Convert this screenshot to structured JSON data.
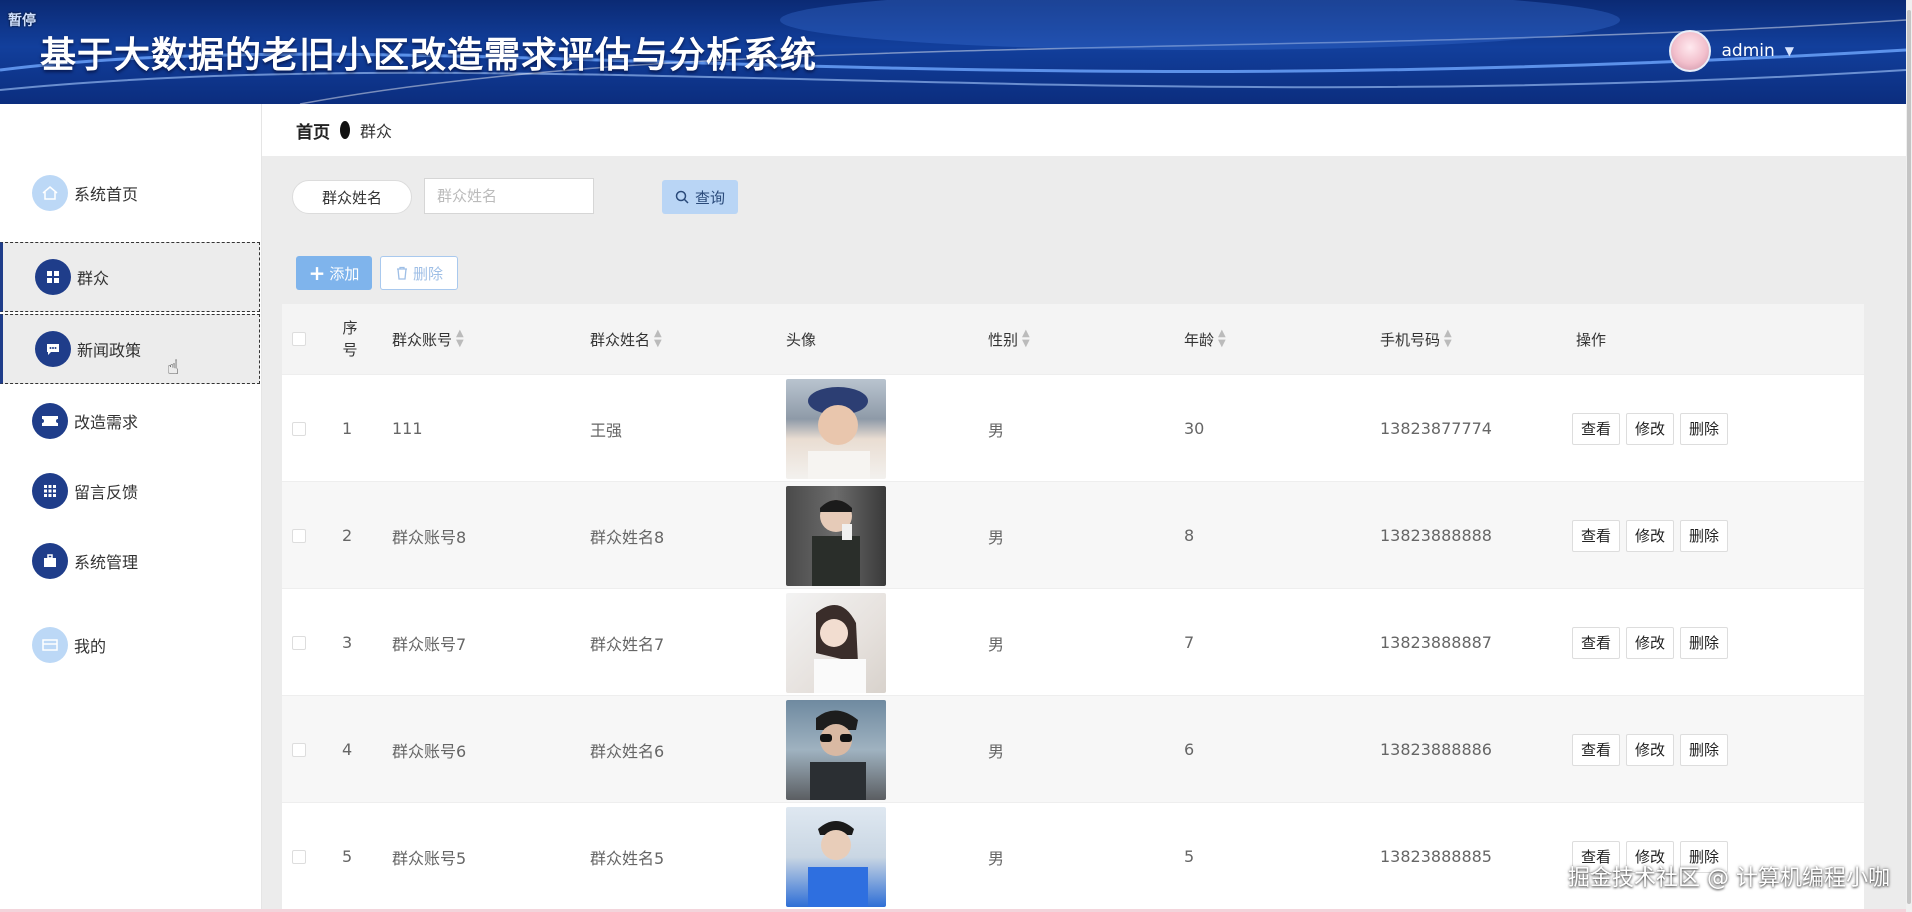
{
  "header": {
    "pause_label": "暂停",
    "title": "基于大数据的老旧小区改造需求评估与分析系统",
    "user_name": "admin"
  },
  "sidebar": {
    "items": [
      {
        "label": "系统首页",
        "icon": "home-icon"
      },
      {
        "label": "群众",
        "icon": "grid-icon"
      },
      {
        "label": "新闻政策",
        "icon": "chat-icon"
      },
      {
        "label": "改造需求",
        "icon": "ticket-icon"
      },
      {
        "label": "留言反馈",
        "icon": "apps-icon"
      },
      {
        "label": "系统管理",
        "icon": "briefcase-icon"
      },
      {
        "label": "我的",
        "icon": "card-icon"
      }
    ],
    "active_index": 1
  },
  "breadcrumb": {
    "home": "首页",
    "current": "群众"
  },
  "search": {
    "label": "群众姓名",
    "placeholder": "群众姓名",
    "button": "查询"
  },
  "actions": {
    "add": "添加",
    "delete": "删除"
  },
  "table": {
    "columns": {
      "index": "序号",
      "account": "群众账号",
      "name": "群众姓名",
      "avatar": "头像",
      "gender": "性别",
      "age": "年龄",
      "phone": "手机号码",
      "ops": "操作"
    },
    "op_labels": {
      "view": "查看",
      "edit": "修改",
      "delete": "删除"
    },
    "rows": [
      {
        "index": "1",
        "account": "111",
        "name": "王强",
        "gender": "男",
        "age": "30",
        "phone": "13823877774"
      },
      {
        "index": "2",
        "account": "群众账号8",
        "name": "群众姓名8",
        "gender": "男",
        "age": "8",
        "phone": "13823888888"
      },
      {
        "index": "3",
        "account": "群众账号7",
        "name": "群众姓名7",
        "gender": "男",
        "age": "7",
        "phone": "13823888887"
      },
      {
        "index": "4",
        "account": "群众账号6",
        "name": "群众姓名6",
        "gender": "男",
        "age": "6",
        "phone": "13823888886"
      },
      {
        "index": "5",
        "account": "群众账号5",
        "name": "群众姓名5",
        "gender": "男",
        "age": "5",
        "phone": "13823888885"
      }
    ]
  },
  "watermark": "掘金技术社区 @ 计算机编程小咖",
  "colors": {
    "header": "#123f9c",
    "menu_icon": "#1f3d8a",
    "primary": "#7fb4ec"
  }
}
